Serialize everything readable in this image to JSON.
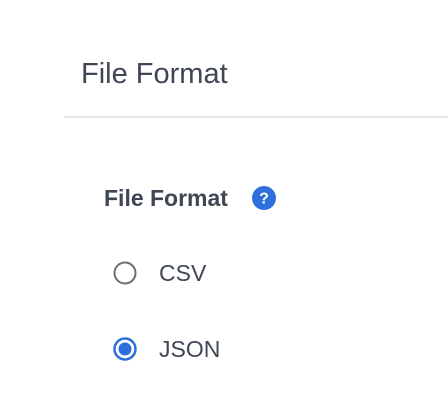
{
  "header": {
    "title": "File Format"
  },
  "field": {
    "label": "File Format",
    "help_icon": "question-circle-icon",
    "options": [
      {
        "label": "CSV",
        "selected": false
      },
      {
        "label": "JSON",
        "selected": true
      }
    ]
  },
  "colors": {
    "text": "#3f4654",
    "accent": "#2f6fdc",
    "radio_border": "#6b6f75",
    "divider": "#e5e7eb"
  }
}
